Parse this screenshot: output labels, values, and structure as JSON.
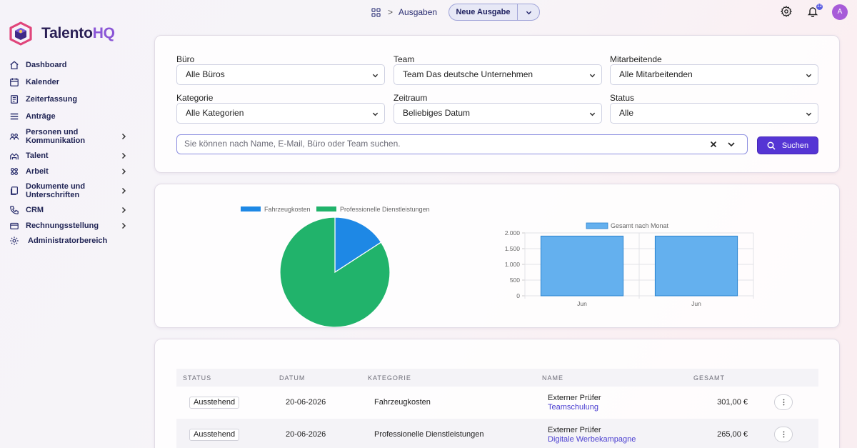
{
  "brand": {
    "name_part1": "Talento",
    "name_part2": "HQ"
  },
  "sidebar": {
    "items": [
      {
        "label": "Dashboard",
        "icon": "home-icon",
        "has_chevron": false
      },
      {
        "label": "Kalender",
        "icon": "calendar-icon",
        "has_chevron": false
      },
      {
        "label": "Zeiterfassung",
        "icon": "timesheet-icon",
        "has_chevron": false
      },
      {
        "label": "Anträge",
        "icon": "list-icon",
        "has_chevron": false
      },
      {
        "label": "Personen und Kommunikation",
        "icon": "people-icon",
        "has_chevron": true
      },
      {
        "label": "Talent",
        "icon": "talent-icon",
        "has_chevron": true
      },
      {
        "label": "Arbeit",
        "icon": "work-icon",
        "has_chevron": true
      },
      {
        "label": "Dokumente und Unterschriften",
        "icon": "documents-icon",
        "has_chevron": true
      },
      {
        "label": "CRM",
        "icon": "phone-icon",
        "has_chevron": true
      },
      {
        "label": "Rechnungsstellung",
        "icon": "billing-icon",
        "has_chevron": true
      },
      {
        "label": "Administratorbereich",
        "icon": "gear-icon",
        "has_chevron": false
      }
    ]
  },
  "header": {
    "breadcrumb": "Ausgaben",
    "new_button": "Neue Ausgabe",
    "notification_count": "12",
    "avatar_initial": "A"
  },
  "filters": {
    "buero": {
      "label": "Büro",
      "value": "Alle Büros"
    },
    "team": {
      "label": "Team",
      "value": "Team Das deutsche Unternehmen"
    },
    "mitarbeitende": {
      "label": "Mitarbeitende",
      "value": "Alle Mitarbeitenden"
    },
    "kategorie": {
      "label": "Kategorie",
      "value": "Alle Kategorien"
    },
    "zeitraum": {
      "label": "Zeitraum",
      "value": "Beliebiges Datum"
    },
    "status": {
      "label": "Status",
      "value": "Alle"
    },
    "search_placeholder": "Sie können nach Name, E-Mail, Büro oder Team suchen.",
    "search_button": "Suchen"
  },
  "chart_data": [
    {
      "type": "pie",
      "legend_position": "top",
      "labels": [
        "Fahrzeugkosten",
        "Professionelle Dienstleistungen"
      ],
      "values": [
        301,
        1600
      ],
      "colors": [
        "#1e88e5",
        "#21b36b"
      ]
    },
    {
      "type": "bar",
      "legend_position": "top",
      "series": [
        {
          "name": "Gesamt nach Monat",
          "values": [
            1900,
            1900
          ],
          "color": "#64b0ee"
        }
      ],
      "categories": [
        "Jun",
        "Jun"
      ],
      "ylim": [
        0,
        2000
      ],
      "yticks": [
        "2.000",
        "1.500",
        "1.000",
        "500",
        "0"
      ],
      "grid": true
    }
  ],
  "table": {
    "columns": [
      "STATUS",
      "DATUM",
      "KATEGORIE",
      "NAME",
      "GESAMT"
    ],
    "rows": [
      {
        "status": "Ausstehend",
        "date": "20-06-2026",
        "category": "Fahrzeugkosten",
        "name": "Externer Prüfer",
        "sub": "Teamschulung",
        "total": "301,00 €"
      },
      {
        "status": "Ausstehend",
        "date": "20-06-2026",
        "category": "Professionelle Dienstleistungen",
        "name": "Externer Prüfer",
        "sub": "Digitale Werbekampagne",
        "total": "265,00 €"
      }
    ]
  }
}
